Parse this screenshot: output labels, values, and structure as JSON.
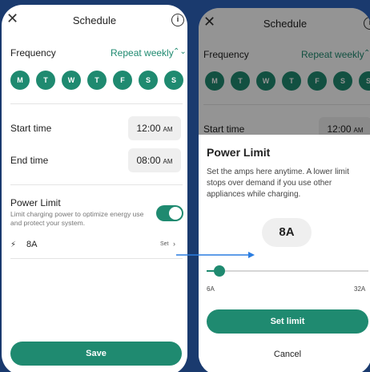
{
  "header": {
    "title": "Schedule",
    "close_glyph": "✕",
    "info_glyph": "i"
  },
  "frequency": {
    "label": "Frequency",
    "value": "Repeat weekly",
    "chevron": "⌃⌄"
  },
  "days": [
    "M",
    "T",
    "W",
    "T",
    "F",
    "S",
    "S"
  ],
  "start_time": {
    "label": "Start time",
    "time": "12:00",
    "ampm": "AM"
  },
  "end_time": {
    "label": "End time",
    "time": "08:00",
    "ampm": "AM"
  },
  "power_limit": {
    "title": "Power Limit",
    "description": "Limit charging power to optimize energy use and protect your system.",
    "enabled": true,
    "amp_icon": "⚡",
    "amps": "8A",
    "set_label": "Set",
    "set_chevron": "›"
  },
  "save_label": "Save",
  "sheet": {
    "title": "Power Limit",
    "description": "Set the amps here anytime. A lower limit stops over demand if you use other appliances while charging.",
    "value": "8A",
    "slider_fraction": 0.08,
    "min_label": "6A",
    "max_label": "32A",
    "set_limit_label": "Set limit",
    "cancel_label": "Cancel"
  },
  "colors": {
    "accent": "#1f8a70",
    "background": "#1a3a6e",
    "arrow": "#2a7de1"
  },
  "icons": {
    "close": "close-icon",
    "info": "info-icon",
    "bolt": "bolt-icon",
    "arrow": "arrow-right-icon"
  }
}
